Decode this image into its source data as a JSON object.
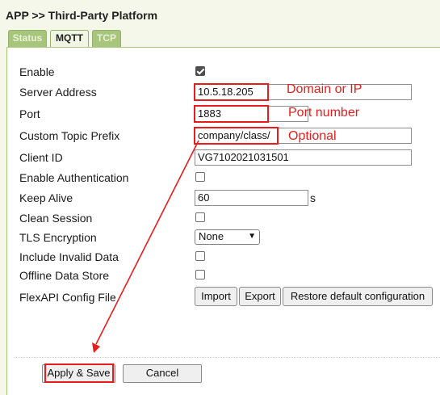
{
  "header": {
    "title": "APP >> Third-Party Platform"
  },
  "tabs": [
    {
      "label": "Status"
    },
    {
      "label": "MQTT"
    },
    {
      "label": "TCP"
    }
  ],
  "form": {
    "enable": {
      "label": "Enable",
      "checked": true
    },
    "server_address": {
      "label": "Server Address",
      "value": "10.5.18.205"
    },
    "port": {
      "label": "Port",
      "value": "1883"
    },
    "custom_topic_prefix": {
      "label": "Custom Topic Prefix",
      "value": "company/class/"
    },
    "client_id": {
      "label": "Client ID",
      "value": "VG7102021031501"
    },
    "enable_authentication": {
      "label": "Enable Authentication",
      "checked": false
    },
    "keep_alive": {
      "label": "Keep Alive",
      "value": "60",
      "unit": "s"
    },
    "clean_session": {
      "label": "Clean Session",
      "checked": false
    },
    "tls_encryption": {
      "label": "TLS Encryption",
      "value": "None"
    },
    "include_invalid_data": {
      "label": "Include Invalid Data",
      "checked": false
    },
    "offline_data_store": {
      "label": "Offline Data Store",
      "checked": false
    },
    "flexapi_config_file": {
      "label": "FlexAPI Config File",
      "import_label": "Import",
      "export_label": "Export",
      "restore_label": "Restore default configuration"
    }
  },
  "annotations": {
    "domain_or_ip": "Domain or IP",
    "port_number": "Port number",
    "optional": "Optional"
  },
  "actions": {
    "apply_label": "Apply & Save",
    "cancel_label": "Cancel"
  },
  "colors": {
    "annotation": "#e81c1c",
    "tab_inactive": "#a7c57b",
    "background": "#f4f7e9"
  }
}
